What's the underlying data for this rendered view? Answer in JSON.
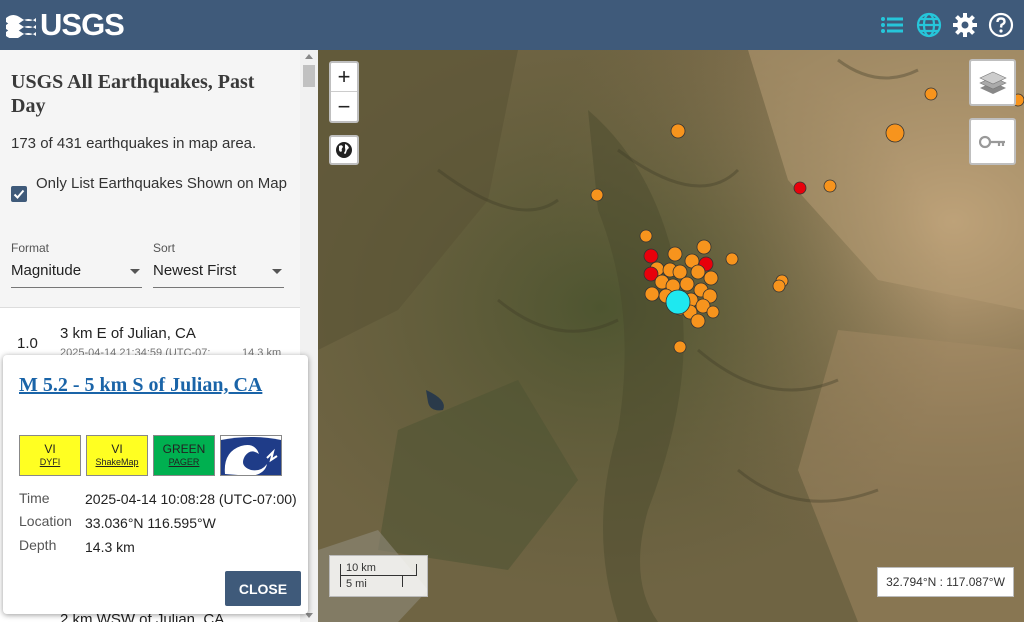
{
  "header": {
    "logo_text": "USGS",
    "icons": [
      "list-icon",
      "globe-icon",
      "gear-icon",
      "help-icon"
    ],
    "color": "#3f5a7a"
  },
  "sidebar": {
    "title": "USGS All Earthquakes, Past Day",
    "count_text": "173 of 431 earthquakes in map area.",
    "only_list_label": "Only List Earthquakes Shown on Map",
    "only_list_checked": true,
    "format": {
      "label": "Format",
      "value": "Magnitude"
    },
    "sort": {
      "label": "Sort",
      "value": "Newest First"
    },
    "list": [
      {
        "mag": "1.0",
        "place": "3 km E of Julian, CA",
        "time": "2025-04-14 21:34:59 (UTC-07:",
        "depth": "14.3 km"
      },
      {
        "place": "2 km WSW of Julian, CA"
      }
    ]
  },
  "map": {
    "zoom_in": "+",
    "zoom_out": "−",
    "scale": {
      "km": "10 km",
      "mi": "5 mi"
    },
    "coords": "32.794°N : 117.087°W",
    "marker_colors": {
      "orange": "#f7941d",
      "red": "#e8000b",
      "selected": "#1ee8f0"
    }
  },
  "popup": {
    "title": "M 5.2 - 5 km S of Julian, CA",
    "badges": [
      {
        "top": "VI",
        "bottom": "DYFI",
        "color": "#ffff22"
      },
      {
        "top": "VI",
        "bottom": "ShakeMap",
        "color": "#ffff22"
      },
      {
        "top": "GREEN",
        "bottom": "PAGER",
        "color": "#00b050"
      }
    ],
    "time_label": "Time",
    "time_value": "2025-04-14 10:08:28 (UTC-07:00)",
    "location_label": "Location",
    "location_value": "33.036°N 116.595°W",
    "depth_label": "Depth",
    "depth_value": "14.3 km",
    "close_label": "CLOSE"
  }
}
